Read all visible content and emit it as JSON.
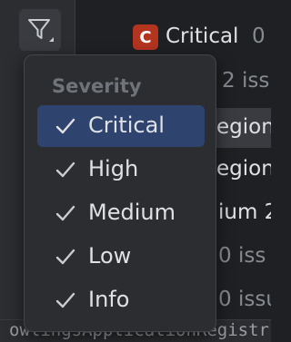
{
  "background": {
    "critical_label": "Critical",
    "critical_count": "0",
    "badge_letter": "C",
    "row2": "2 iss",
    "row3": "egion",
    "row4": "egion",
    "row5": "ium 2",
    "row6": "0 iss",
    "row7": "0 issu",
    "status_bar": "owlingsApplicationRegistr"
  },
  "menu": {
    "header": "Severity",
    "items": [
      {
        "label": "Critical",
        "checked": true,
        "selected": true
      },
      {
        "label": "High",
        "checked": true,
        "selected": false
      },
      {
        "label": "Medium",
        "checked": true,
        "selected": false
      },
      {
        "label": "Low",
        "checked": true,
        "selected": false
      },
      {
        "label": "Info",
        "checked": true,
        "selected": false
      }
    ]
  },
  "colors": {
    "selected_row": "#2e436e",
    "critical_badge": "#b3341f",
    "panel": "#2b2d30"
  }
}
